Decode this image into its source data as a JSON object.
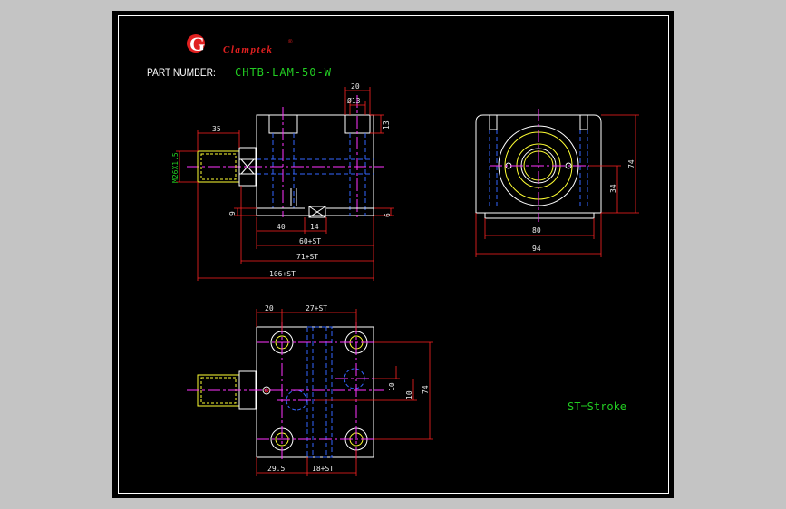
{
  "brand": {
    "logo_letter": "G",
    "name": "Clamptek",
    "registered": "®",
    "logo_color": "#e02020"
  },
  "part_number": {
    "label": "PART NUMBER:",
    "value": "CHTB-LAM-50-W",
    "value_color": "#22cc22"
  },
  "dimensions": {
    "side_top_width": "20",
    "side_bore": "Ø13",
    "side_depth": "13",
    "side_thread_len": "35",
    "thread_spec": "M26X1.5",
    "side_height_9": "9",
    "side_offset_40": "40",
    "side_offset_14": "14",
    "side_right_6": "6",
    "side_len_60st": "60+ST",
    "side_len_71st": "71+ST",
    "side_len_106st": "106+ST",
    "end_height_74": "74",
    "end_center_34": "34",
    "end_width_80": "80",
    "end_width_94": "94",
    "top_left_20": "20",
    "top_27st": "27+ST",
    "top_10a": "10",
    "top_10b": "10",
    "top_74": "74",
    "top_29_5": "29.5",
    "top_18st": "18+ST"
  },
  "legend": {
    "stroke_note": "ST=Stroke",
    "color": "#22cc22"
  },
  "colors": {
    "outline": "#ffffff",
    "hidden": "#3366ff",
    "center": "#ff33ff",
    "dimension": "#ff2222",
    "thread": "#ffff33",
    "background": "#000000",
    "canvas_border": "#c4c4c4"
  }
}
